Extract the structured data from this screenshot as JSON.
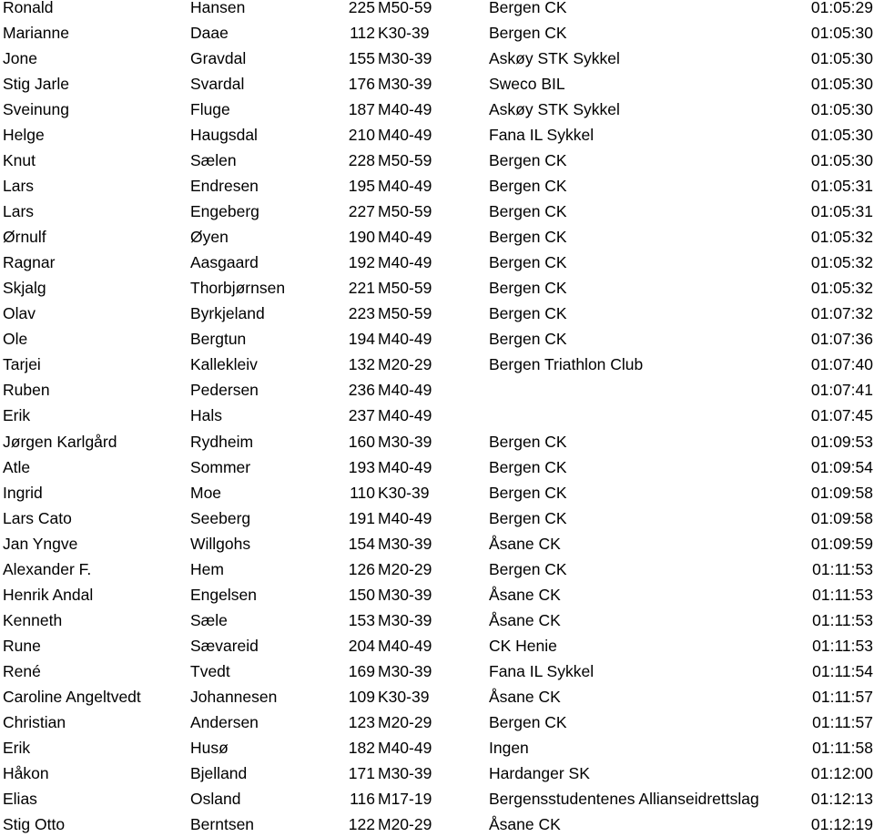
{
  "results": [
    {
      "first": "Ronald",
      "last": "Hansen",
      "number": "225",
      "class": "M50-59",
      "club": "Bergen CK",
      "time": "01:05:29"
    },
    {
      "first": "Marianne",
      "last": "Daae",
      "number": "112",
      "class": "K30-39",
      "club": "Bergen CK",
      "time": "01:05:30"
    },
    {
      "first": "Jone",
      "last": "Gravdal",
      "number": "155",
      "class": "M30-39",
      "club": "Askøy STK Sykkel",
      "time": "01:05:30"
    },
    {
      "first": "Stig Jarle",
      "last": "Svardal",
      "number": "176",
      "class": "M30-39",
      "club": "Sweco BIL",
      "time": "01:05:30"
    },
    {
      "first": "Sveinung",
      "last": "Fluge",
      "number": "187",
      "class": "M40-49",
      "club": "Askøy STK Sykkel",
      "time": "01:05:30"
    },
    {
      "first": "Helge",
      "last": "Haugsdal",
      "number": "210",
      "class": "M40-49",
      "club": "Fana IL Sykkel",
      "time": "01:05:30"
    },
    {
      "first": "Knut",
      "last": "Sælen",
      "number": "228",
      "class": "M50-59",
      "club": "Bergen CK",
      "time": "01:05:30"
    },
    {
      "first": "Lars",
      "last": "Endresen",
      "number": "195",
      "class": "M40-49",
      "club": "Bergen CK",
      "time": "01:05:31"
    },
    {
      "first": "Lars",
      "last": "Engeberg",
      "number": "227",
      "class": "M50-59",
      "club": "Bergen CK",
      "time": "01:05:31"
    },
    {
      "first": "Ørnulf",
      "last": "Øyen",
      "number": "190",
      "class": "M40-49",
      "club": "Bergen CK",
      "time": "01:05:32"
    },
    {
      "first": "Ragnar",
      "last": "Aasgaard",
      "number": "192",
      "class": "M40-49",
      "club": "Bergen CK",
      "time": "01:05:32"
    },
    {
      "first": "Skjalg",
      "last": "Thorbjørnsen",
      "number": "221",
      "class": "M50-59",
      "club": "Bergen CK",
      "time": "01:05:32"
    },
    {
      "first": "Olav",
      "last": "Byrkjeland",
      "number": "223",
      "class": "M50-59",
      "club": "Bergen CK",
      "time": "01:07:32"
    },
    {
      "first": "Ole",
      "last": "Bergtun",
      "number": "194",
      "class": "M40-49",
      "club": "Bergen CK",
      "time": "01:07:36"
    },
    {
      "first": "Tarjei",
      "last": "Kallekleiv",
      "number": "132",
      "class": "M20-29",
      "club": "Bergen Triathlon Club",
      "time": "01:07:40"
    },
    {
      "first": "Ruben",
      "last": "Pedersen",
      "number": "236",
      "class": "M40-49",
      "club": "",
      "time": "01:07:41"
    },
    {
      "first": "Erik",
      "last": "Hals",
      "number": "237",
      "class": "M40-49",
      "club": "",
      "time": "01:07:45"
    },
    {
      "first": "Jørgen Karlgård",
      "last": "Rydheim",
      "number": "160",
      "class": "M30-39",
      "club": "Bergen CK",
      "time": "01:09:53"
    },
    {
      "first": "Atle",
      "last": "Sommer",
      "number": "193",
      "class": "M40-49",
      "club": "Bergen CK",
      "time": "01:09:54"
    },
    {
      "first": "Ingrid",
      "last": "Moe",
      "number": "110",
      "class": "K30-39",
      "club": "Bergen CK",
      "time": "01:09:58"
    },
    {
      "first": "Lars Cato",
      "last": "Seeberg",
      "number": "191",
      "class": "M40-49",
      "club": "Bergen CK",
      "time": "01:09:58"
    },
    {
      "first": "Jan Yngve",
      "last": "Willgohs",
      "number": "154",
      "class": "M30-39",
      "club": "Åsane CK",
      "time": "01:09:59"
    },
    {
      "first": "Alexander F.",
      "last": "Hem",
      "number": "126",
      "class": "M20-29",
      "club": "Bergen CK",
      "time": "01:11:53"
    },
    {
      "first": "Henrik Andal",
      "last": "Engelsen",
      "number": "150",
      "class": "M30-39",
      "club": "Åsane CK",
      "time": "01:11:53"
    },
    {
      "first": "Kenneth",
      "last": "Sæle",
      "number": "153",
      "class": "M30-39",
      "club": "Åsane CK",
      "time": "01:11:53"
    },
    {
      "first": "Rune",
      "last": "Sævareid",
      "number": "204",
      "class": "M40-49",
      "club": "CK Henie",
      "time": "01:11:53"
    },
    {
      "first": "René",
      "last": "Tvedt",
      "number": "169",
      "class": "M30-39",
      "club": "Fana IL Sykkel",
      "time": "01:11:54"
    },
    {
      "first": "Caroline Angeltvedt",
      "last": "Johannesen",
      "number": "109",
      "class": "K30-39",
      "club": "Åsane CK",
      "time": "01:11:57"
    },
    {
      "first": "Christian",
      "last": "Andersen",
      "number": "123",
      "class": "M20-29",
      "club": "Bergen CK",
      "time": "01:11:57"
    },
    {
      "first": "Erik",
      "last": "Husø",
      "number": "182",
      "class": "M40-49",
      "club": "Ingen",
      "time": "01:11:58"
    },
    {
      "first": "Håkon",
      "last": "Bjelland",
      "number": "171",
      "class": "M30-39",
      "club": "Hardanger SK",
      "time": "01:12:00"
    },
    {
      "first": "Elias",
      "last": "Osland",
      "number": "116",
      "class": "M17-19",
      "club": "Bergensstudentenes Allianseidrettslag",
      "time": "01:12:13"
    },
    {
      "first": "Stig Otto",
      "last": "Berntsen",
      "number": "122",
      "class": "M20-29",
      "club": "Åsane CK",
      "time": "01:12:19"
    }
  ]
}
